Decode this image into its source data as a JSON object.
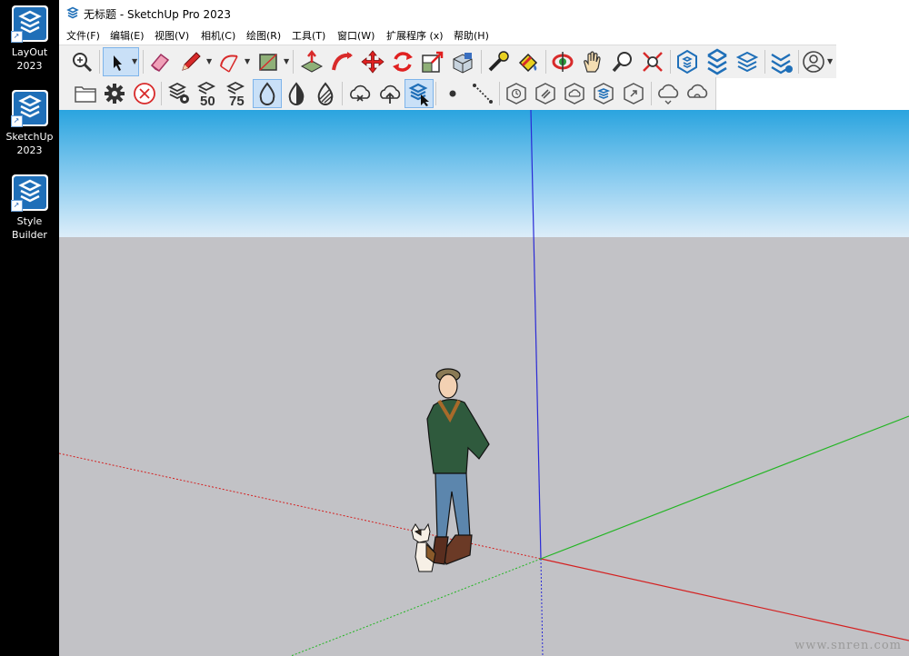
{
  "desktop": {
    "icons": [
      {
        "name": "layout-2023",
        "label": "LayOut 2023"
      },
      {
        "name": "sketchup-2023",
        "label_line1": "SketchUp",
        "label_line2": "2023"
      },
      {
        "name": "style-builder",
        "label": "Style Builder"
      }
    ]
  },
  "window": {
    "title": "无标题 - SketchUp Pro 2023"
  },
  "menubar": {
    "items": [
      "文件(F)",
      "编辑(E)",
      "视图(V)",
      "相机(C)",
      "绘图(R)",
      "工具(T)",
      "窗口(W)",
      "扩展程序 (x)",
      "帮助(H)"
    ]
  },
  "toolbar_primary": {
    "tools": [
      "zoom-extents-icon",
      "select-icon",
      "eraser-icon",
      "pencil-icon",
      "arc-icon",
      "rectangle-icon",
      "push-pull-icon",
      "follow-me-icon",
      "move-icon",
      "rotate-icon",
      "scale-icon",
      "offset-icon",
      "tape-measure-icon",
      "paint-bucket-icon",
      "orbit-icon",
      "pan-icon",
      "zoom-icon",
      "zoom-window-icon",
      "warehouse-icon",
      "extension-warehouse-icon",
      "send-to-layout-icon",
      "extension-manager-icon",
      "account-icon"
    ]
  },
  "toolbar_secondary": {
    "icon_50": "50",
    "icon_75": "75"
  },
  "scene": {
    "sky_top": "#2aa4df",
    "sky_bottom": "#d8ecf8",
    "ground": "#c2c2c6",
    "axis_blue": "#2a2ad6",
    "axis_red": "#d42020",
    "axis_green": "#22b522"
  },
  "watermark": "www.snren.com"
}
